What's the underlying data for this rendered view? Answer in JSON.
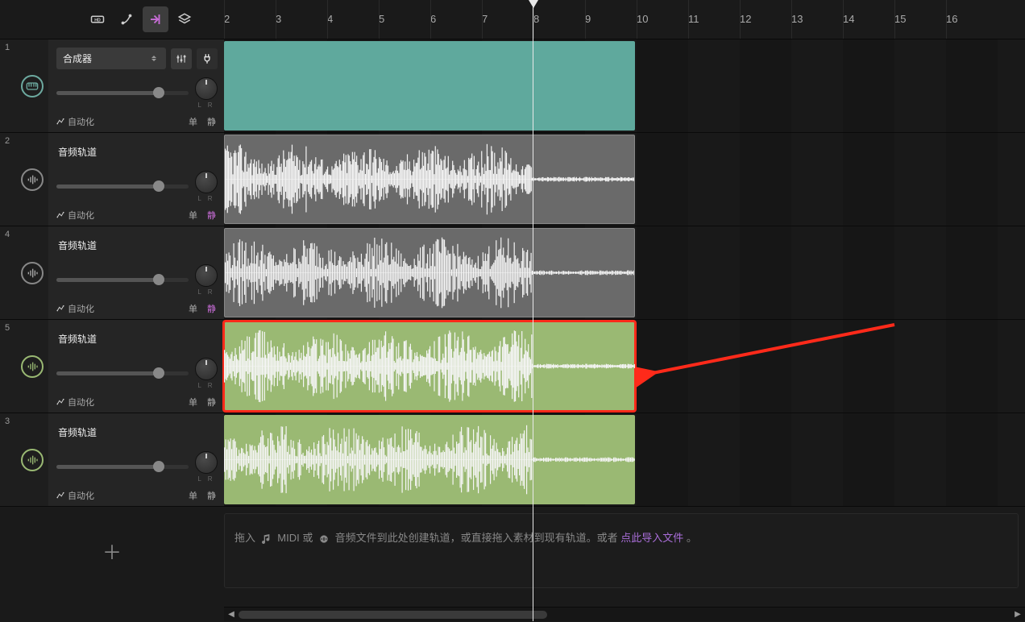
{
  "toolbar": {
    "hd_label": "HD"
  },
  "ruler": {
    "start": 2,
    "end": 16
  },
  "tracks": [
    {
      "num": "1",
      "type": "synth",
      "name": "合成器",
      "automation": "自动化",
      "solo": "单",
      "mute": "静",
      "mute_active": false,
      "lr": "L   R",
      "clip_color": "synth",
      "show_waveform": false,
      "highlighted": false
    },
    {
      "num": "2",
      "type": "audio",
      "name": "音频轨道",
      "automation": "自动化",
      "solo": "单",
      "mute": "静",
      "mute_active": true,
      "lr": "L   R",
      "clip_color": "audio-gray",
      "show_waveform": true,
      "highlighted": false
    },
    {
      "num": "4",
      "type": "audio",
      "name": "音频轨道",
      "automation": "自动化",
      "solo": "单",
      "mute": "静",
      "mute_active": true,
      "lr": "L   R",
      "clip_color": "audio-gray",
      "show_waveform": true,
      "highlighted": false
    },
    {
      "num": "5",
      "type": "audio-green",
      "name": "音频轨道",
      "automation": "自动化",
      "solo": "单",
      "mute": "静",
      "mute_active": false,
      "lr": "L   R",
      "clip_color": "audio-green",
      "show_waveform": true,
      "highlighted": true
    },
    {
      "num": "3",
      "type": "audio-green",
      "name": "音频轨道",
      "automation": "自动化",
      "solo": "单",
      "mute": "静",
      "mute_active": false,
      "lr": "L   R",
      "clip_color": "audio-green",
      "show_waveform": true,
      "highlighted": false
    }
  ],
  "drop_zone": {
    "prefix": "拖入",
    "midi": "MIDI 或",
    "audio_text": "音频文件到此处创建轨道，或直接拖入素材到现有轨道。或者",
    "link": "点此导入文件",
    "suffix": "。"
  }
}
